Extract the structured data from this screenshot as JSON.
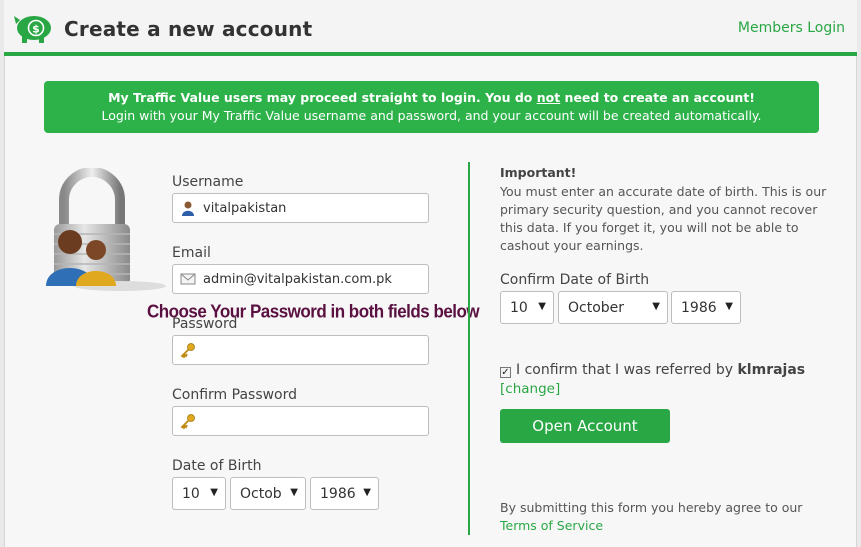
{
  "header": {
    "title": "Create a new account",
    "members_login": "Members Login",
    "accent_color": "#2aa745",
    "logo_icon": "piggy-bank-dollar-icon"
  },
  "notice": {
    "line1_before": "My Traffic Value users may proceed straight to login. You do ",
    "line1_emph": "not",
    "line1_after": " need to create an account!",
    "line2": "Login with your My Traffic Value username and password, and your account will be created automatically."
  },
  "form": {
    "username_label": "Username",
    "username_value": "vitalpakistan",
    "email_label": "Email",
    "email_value": "admin@vitalpakistan.com.pk",
    "choose_password_note": "Choose Your Password in both fields below",
    "password_label": "Password",
    "password_value": "",
    "confirm_password_label": "Confirm Password",
    "confirm_password_value": "",
    "dob_label": "Date of Birth",
    "dob_day": "10",
    "dob_month": "Octob",
    "dob_year": "1986"
  },
  "side": {
    "important_title": "Important!",
    "important_text": "You must enter an accurate date of birth. This is our primary security question, and you cannot recover this data. If you forget it, you will not be able to cashout your earnings.",
    "confirm_dob_label": "Confirm Date of Birth",
    "confirm_day": "10",
    "confirm_month": "October",
    "confirm_year": "1986",
    "referral_text": "I confirm that I was referred by ",
    "referrer": "klmrajas",
    "change_link": "[change]",
    "open_account": "Open Account",
    "tos_text": "By submitting this form you hereby agree to our",
    "tos_link": "Terms of Service"
  }
}
